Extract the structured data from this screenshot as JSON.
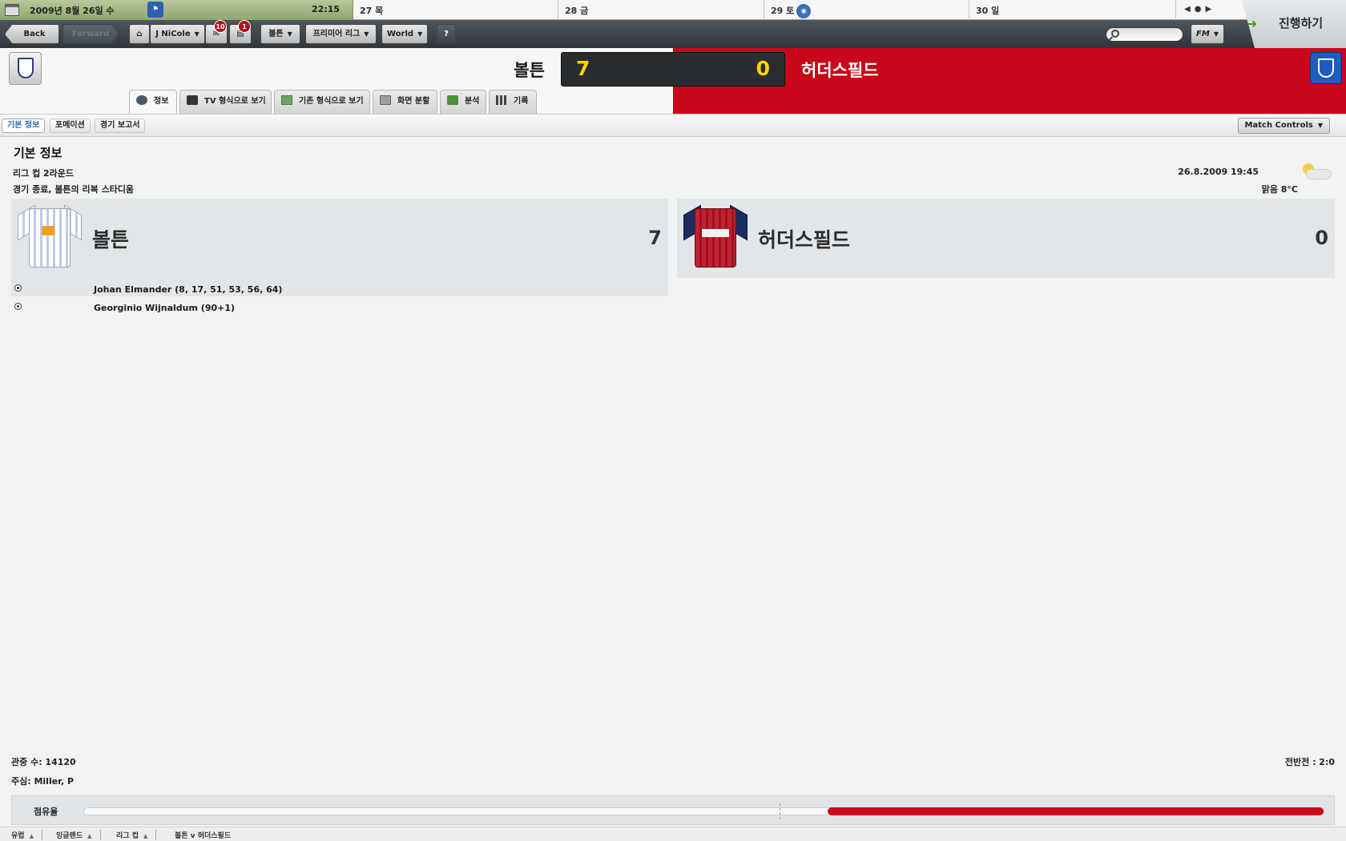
{
  "calendar": {
    "current_date": "2009년 8월 26일 수",
    "current_time": "22:15",
    "days": [
      "27 목",
      "28 금",
      "29 토",
      "30 일"
    ]
  },
  "toolbar": {
    "back_label": "Back",
    "forward_label": "Forward",
    "manager_label": "J NiCole",
    "inbox_count": "10",
    "news_count": "1",
    "club_menu": "볼튼",
    "league_menu": "프리미어 리그",
    "world_menu": "World",
    "help_label": "?",
    "search_placeholder": "",
    "fm_label": "FM",
    "continue_label": "진행하기"
  },
  "match": {
    "home_team": "볼튼",
    "away_team": "허더스필드",
    "home_score": "7",
    "away_score": "0"
  },
  "tabs": [
    {
      "label": "정보",
      "icon": "info-icon"
    },
    {
      "label": "TV 형식으로 보기",
      "icon": "tv-icon"
    },
    {
      "label": "기존 형식으로 보기",
      "icon": "pitch-icon"
    },
    {
      "label": "화면 분할",
      "icon": "split-icon"
    },
    {
      "label": "분석",
      "icon": "analysis-icon"
    },
    {
      "label": "기록",
      "icon": "stats-icon"
    }
  ],
  "subtabs": [
    "기본 정보",
    "포메이션",
    "경기 보고서"
  ],
  "match_controls_label": "Match Controls",
  "info": {
    "section_title": "기본 정보",
    "competition": "리그 컵 2라운드",
    "result_line": "경기 종료, 볼튼의 리복 스타디움",
    "datetime": "26.8.2009 19:45",
    "weather": "맑음 8°C"
  },
  "scorers": {
    "home": [
      "Johan Elmander (8, 17, 51, 53, 56, 64)",
      "Georginio Wijnaldum (90+1)"
    ]
  },
  "footer": {
    "attendance": "관중 수: 14120",
    "referee": "주심: Miller, P",
    "half_time": "전반전 : 2:0",
    "possession_label": "점유율",
    "away_possession": 0.4
  },
  "breadcrumbs": [
    "유럽",
    "잉글랜드",
    "리그 컵",
    "볼튼 v 허더스필드"
  ],
  "colors": {
    "away_accent": "#c8081a",
    "score_yellow": "#ffd200",
    "continue_arrow": "#4c9a1c"
  }
}
